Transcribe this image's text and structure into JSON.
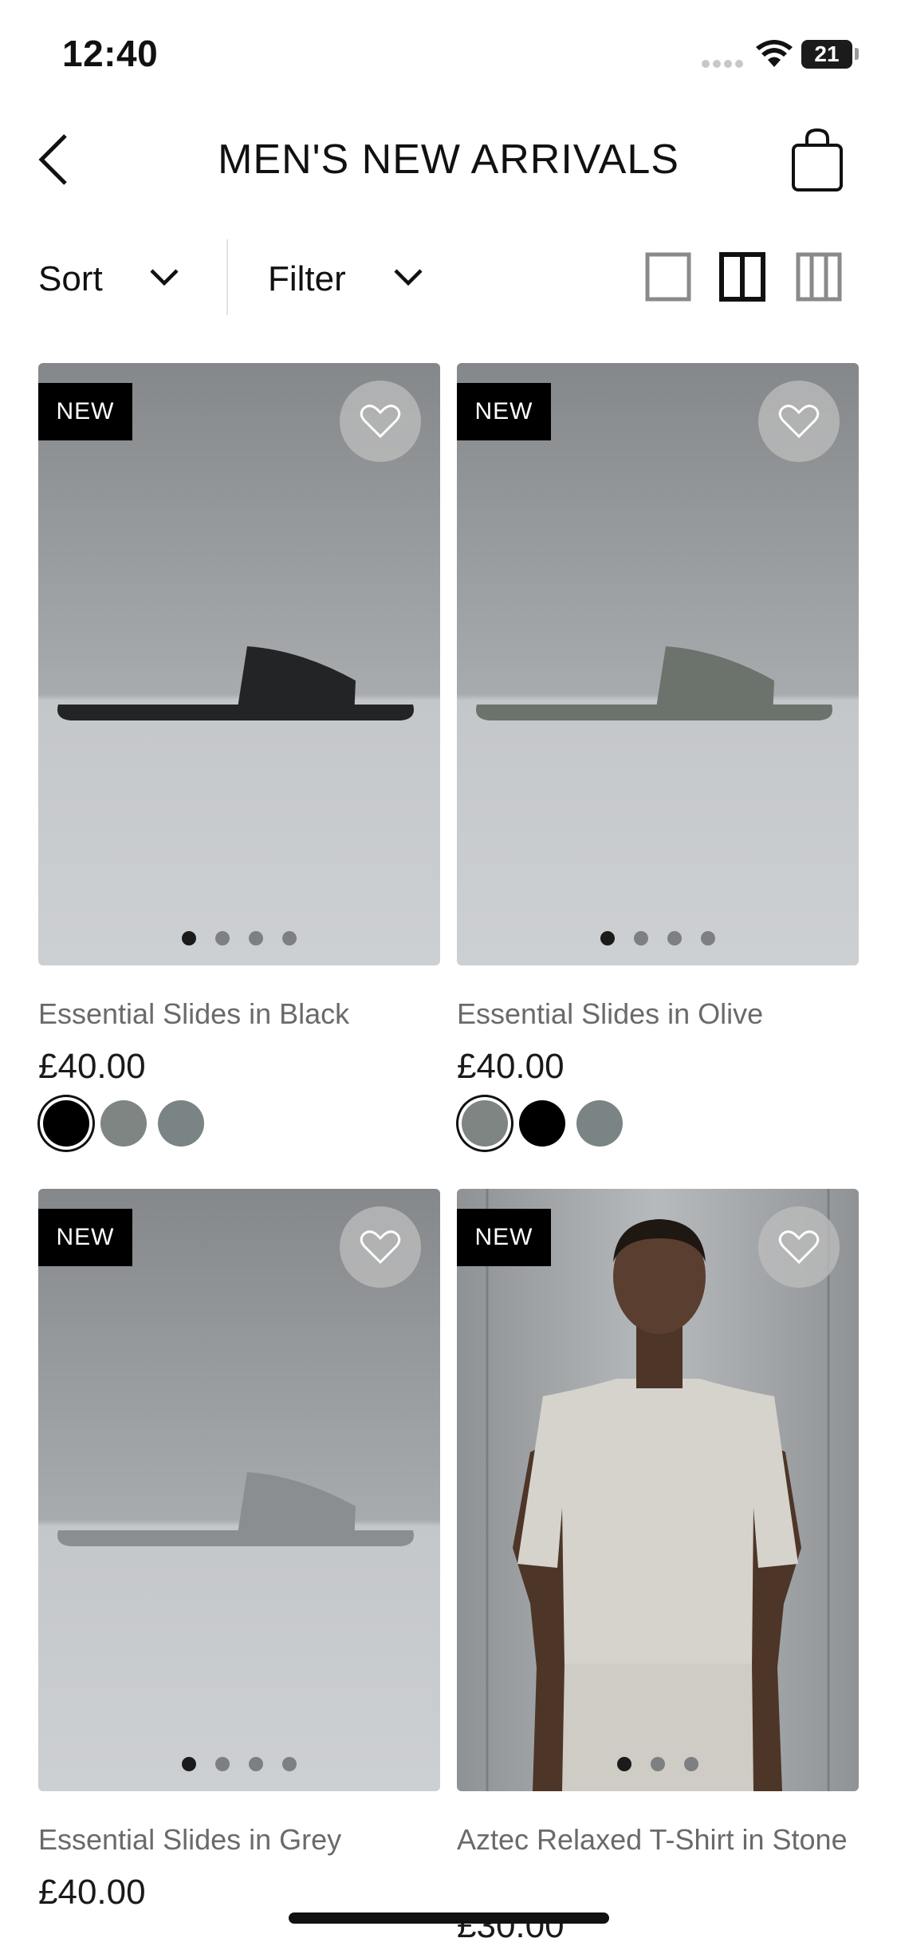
{
  "status": {
    "time": "12:40",
    "battery": "21"
  },
  "header": {
    "title": "MEN'S NEW ARRIVALS"
  },
  "toolbar": {
    "sort_label": "Sort",
    "filter_label": "Filter"
  },
  "products": [
    {
      "name": "Essential Slides in Black",
      "price": "£40.00",
      "badge": "NEW",
      "slide_color": "#232425",
      "swatches": [
        "#000000",
        "#7f8582",
        "#7a8484"
      ]
    },
    {
      "name": "Essential Slides in Olive",
      "price": "£40.00",
      "badge": "NEW",
      "slide_color": "#6c736d",
      "swatches": [
        "#7f8582",
        "#000000",
        "#7a8484"
      ]
    },
    {
      "name": "Essential Slides in Grey",
      "price": "£40.00",
      "badge": "NEW",
      "slide_color": "#8b8e90",
      "swatches": []
    },
    {
      "name": "Aztec Relaxed T-Shirt in Stone",
      "price": "£30.00",
      "badge": "NEW",
      "slide_color": "",
      "swatches": []
    }
  ],
  "icons": {
    "back": "chevron-left-icon",
    "bag": "shopping-bag-icon",
    "heart": "heart-icon",
    "views": [
      "single-column-view-icon",
      "two-column-view-icon",
      "three-column-view-icon"
    ]
  }
}
